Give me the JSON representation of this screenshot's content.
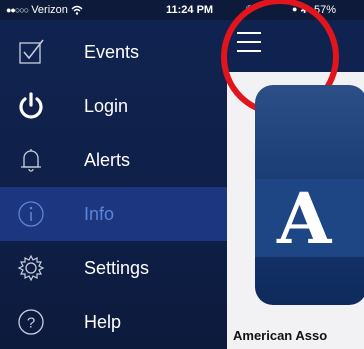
{
  "status_bar": {
    "signal_dots": "●●○○○",
    "carrier": "Verizon",
    "time": "11:24 PM",
    "battery_percent": "57%"
  },
  "sidebar": {
    "items": [
      {
        "label": "Events",
        "icon": "events-checkbox-icon",
        "active": false
      },
      {
        "label": "Login",
        "icon": "power-icon",
        "active": false
      },
      {
        "label": "Alerts",
        "icon": "bell-icon",
        "active": false
      },
      {
        "label": "Info",
        "icon": "info-icon",
        "active": true
      },
      {
        "label": "Settings",
        "icon": "gear-icon",
        "active": false
      },
      {
        "label": "Help",
        "icon": "question-icon",
        "active": false
      }
    ]
  },
  "main": {
    "menu_button_icon": "hamburger-menu-icon",
    "app_tile_letter": "A",
    "org_name": "American Asso"
  },
  "colors": {
    "sidebar_bg": "#102350",
    "active_item_bg": "#1d3680",
    "active_label": "#5c84d8",
    "highlight_circle": "#e2141c"
  }
}
